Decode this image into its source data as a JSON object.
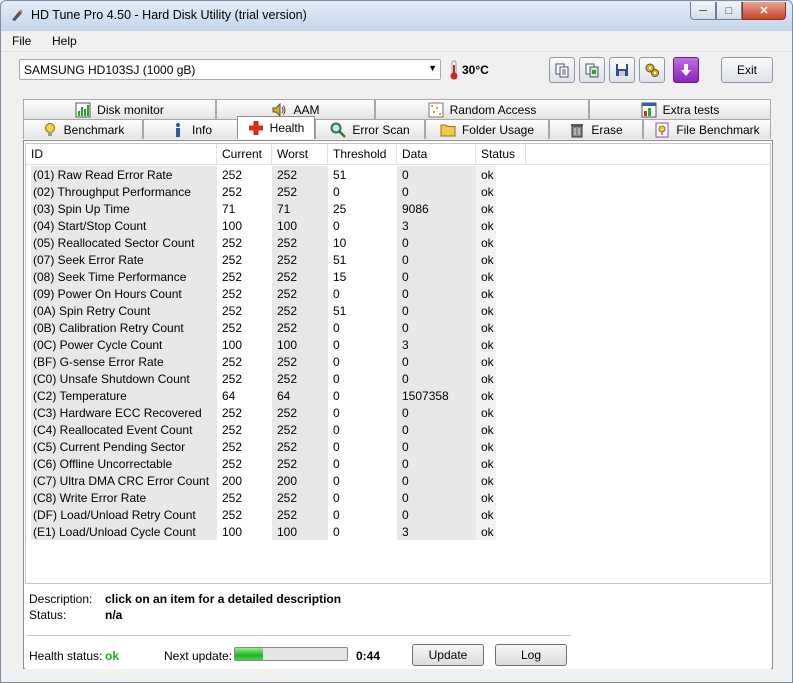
{
  "window": {
    "title": "HD Tune Pro 4.50 - Hard Disk Utility (trial version)"
  },
  "menu": {
    "file": "File",
    "help": "Help"
  },
  "toolbar": {
    "drive": "SAMSUNG HD103SJ (1000 gB)",
    "temperature": "30°C",
    "exit_label": "Exit",
    "icons": [
      "copy-text-icon",
      "copy-screenshot-icon",
      "save-icon",
      "options-icon",
      "download-icon"
    ]
  },
  "tabs": {
    "row1": [
      "Disk monitor",
      "AAM",
      "Random Access",
      "Extra tests"
    ],
    "row2": [
      "Benchmark",
      "Info",
      "Health",
      "Error Scan",
      "Folder Usage",
      "Erase",
      "File Benchmark"
    ],
    "active": "Health"
  },
  "table": {
    "headers": [
      "ID",
      "Current",
      "Worst",
      "Threshold",
      "Data",
      "Status"
    ],
    "rows": [
      [
        "(01) Raw Read Error Rate",
        "252",
        "252",
        "51",
        "0",
        "ok"
      ],
      [
        "(02) Throughput Performance",
        "252",
        "252",
        "0",
        "0",
        "ok"
      ],
      [
        "(03) Spin Up Time",
        "71",
        "71",
        "25",
        "9086",
        "ok"
      ],
      [
        "(04) Start/Stop Count",
        "100",
        "100",
        "0",
        "3",
        "ok"
      ],
      [
        "(05) Reallocated Sector Count",
        "252",
        "252",
        "10",
        "0",
        "ok"
      ],
      [
        "(07) Seek Error Rate",
        "252",
        "252",
        "51",
        "0",
        "ok"
      ],
      [
        "(08) Seek Time Performance",
        "252",
        "252",
        "15",
        "0",
        "ok"
      ],
      [
        "(09) Power On Hours Count",
        "252",
        "252",
        "0",
        "0",
        "ok"
      ],
      [
        "(0A) Spin Retry Count",
        "252",
        "252",
        "51",
        "0",
        "ok"
      ],
      [
        "(0B) Calibration Retry Count",
        "252",
        "252",
        "0",
        "0",
        "ok"
      ],
      [
        "(0C) Power Cycle Count",
        "100",
        "100",
        "0",
        "3",
        "ok"
      ],
      [
        "(BF) G-sense Error Rate",
        "252",
        "252",
        "0",
        "0",
        "ok"
      ],
      [
        "(C0) Unsafe Shutdown Count",
        "252",
        "252",
        "0",
        "0",
        "ok"
      ],
      [
        "(C2) Temperature",
        "64",
        "64",
        "0",
        "1507358",
        "ok"
      ],
      [
        "(C3) Hardware ECC Recovered",
        "252",
        "252",
        "0",
        "0",
        "ok"
      ],
      [
        "(C4) Reallocated Event Count",
        "252",
        "252",
        "0",
        "0",
        "ok"
      ],
      [
        "(C5) Current Pending Sector",
        "252",
        "252",
        "0",
        "0",
        "ok"
      ],
      [
        "(C6) Offline Uncorrectable",
        "252",
        "252",
        "0",
        "0",
        "ok"
      ],
      [
        "(C7) Ultra DMA CRC Error Count",
        "200",
        "200",
        "0",
        "0",
        "ok"
      ],
      [
        "(C8) Write Error Rate",
        "252",
        "252",
        "0",
        "0",
        "ok"
      ],
      [
        "(DF) Load/Unload Retry Count",
        "252",
        "252",
        "0",
        "0",
        "ok"
      ],
      [
        "(E1) Load/Unload Cycle Count",
        "100",
        "100",
        "0",
        "3",
        "ok"
      ]
    ]
  },
  "details": {
    "description_label": "Description:",
    "description_value": "click on an item for a detailed description",
    "status_label": "Status:",
    "status_value": "n/a"
  },
  "footer": {
    "health_label": "Health status:",
    "health_value": "ok",
    "next_update_label": "Next update:",
    "next_update_time": "0:44",
    "progress_fraction": 0.25,
    "update_label": "Update",
    "log_label": "Log"
  },
  "colors": {
    "health_ok": "#22aa22",
    "progress": "#1fb41f",
    "temp_icon": "#d22020"
  }
}
